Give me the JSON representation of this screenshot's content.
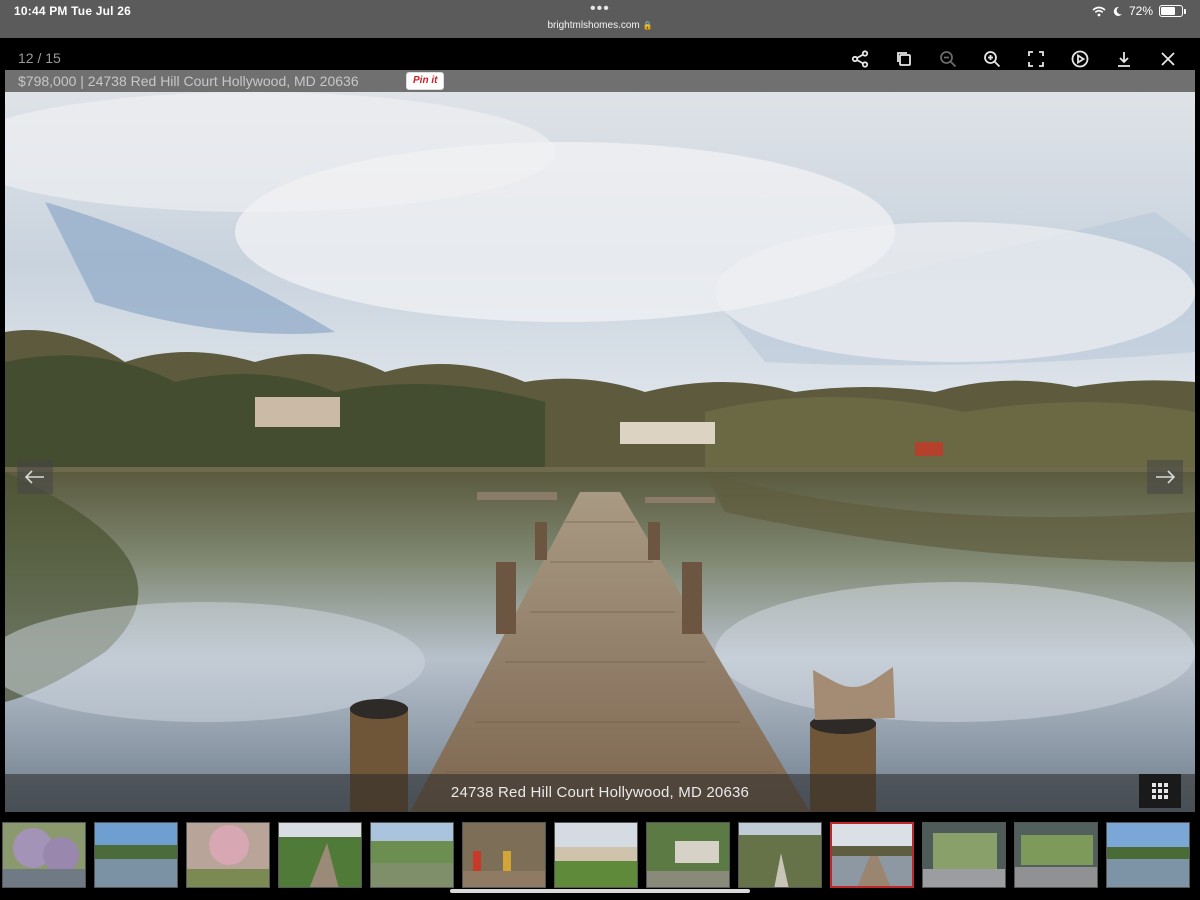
{
  "status_bar": {
    "time": "10:44 PM   Tue Jul 26",
    "dots": "•••",
    "url": "brightmlshomes.com",
    "battery": "72%"
  },
  "gallery": {
    "counter": "12 / 15",
    "caption": "$798,000 | 24738 Red Hill Court Hollywood, MD 20636",
    "pin_label": "Pin it",
    "photo_caption": "24738 Red Hill Court Hollywood, MD 20636",
    "toolbar": [
      "share-icon",
      "copy-icon",
      "zoom-out-icon",
      "zoom-in-icon",
      "fullscreen-icon",
      "play-icon",
      "download-icon",
      "close-icon"
    ],
    "thumbnail_count": 13,
    "active_thumbnail": 10
  },
  "colors": {
    "active_thumb_border": "#c0272d",
    "pin_red": "#cb2027",
    "status_bar_bg": "#5b5b5b"
  }
}
